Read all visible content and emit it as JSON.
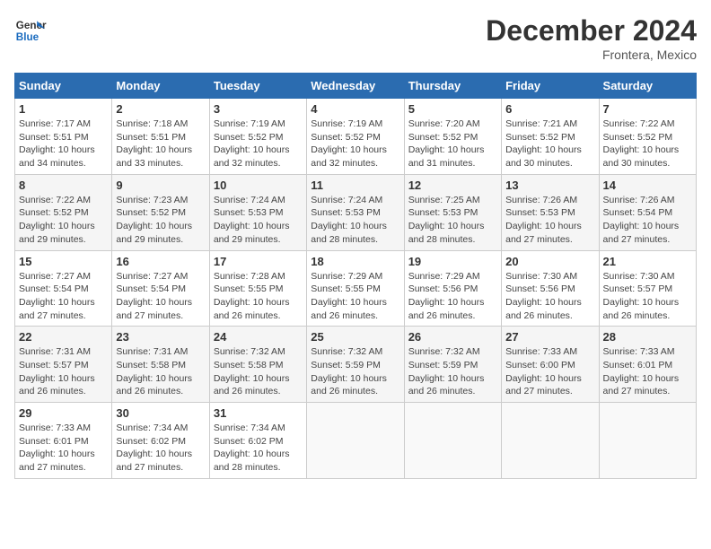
{
  "header": {
    "logo_line1": "General",
    "logo_line2": "Blue",
    "month_title": "December 2024",
    "location": "Frontera, Mexico"
  },
  "weekdays": [
    "Sunday",
    "Monday",
    "Tuesday",
    "Wednesday",
    "Thursday",
    "Friday",
    "Saturday"
  ],
  "weeks": [
    [
      {
        "day": "1",
        "sunrise": "7:17 AM",
        "sunset": "5:51 PM",
        "daylight": "10 hours and 34 minutes."
      },
      {
        "day": "2",
        "sunrise": "7:18 AM",
        "sunset": "5:51 PM",
        "daylight": "10 hours and 33 minutes."
      },
      {
        "day": "3",
        "sunrise": "7:19 AM",
        "sunset": "5:52 PM",
        "daylight": "10 hours and 32 minutes."
      },
      {
        "day": "4",
        "sunrise": "7:19 AM",
        "sunset": "5:52 PM",
        "daylight": "10 hours and 32 minutes."
      },
      {
        "day": "5",
        "sunrise": "7:20 AM",
        "sunset": "5:52 PM",
        "daylight": "10 hours and 31 minutes."
      },
      {
        "day": "6",
        "sunrise": "7:21 AM",
        "sunset": "5:52 PM",
        "daylight": "10 hours and 30 minutes."
      },
      {
        "day": "7",
        "sunrise": "7:22 AM",
        "sunset": "5:52 PM",
        "daylight": "10 hours and 30 minutes."
      }
    ],
    [
      {
        "day": "8",
        "sunrise": "7:22 AM",
        "sunset": "5:52 PM",
        "daylight": "10 hours and 29 minutes."
      },
      {
        "day": "9",
        "sunrise": "7:23 AM",
        "sunset": "5:52 PM",
        "daylight": "10 hours and 29 minutes."
      },
      {
        "day": "10",
        "sunrise": "7:24 AM",
        "sunset": "5:53 PM",
        "daylight": "10 hours and 29 minutes."
      },
      {
        "day": "11",
        "sunrise": "7:24 AM",
        "sunset": "5:53 PM",
        "daylight": "10 hours and 28 minutes."
      },
      {
        "day": "12",
        "sunrise": "7:25 AM",
        "sunset": "5:53 PM",
        "daylight": "10 hours and 28 minutes."
      },
      {
        "day": "13",
        "sunrise": "7:26 AM",
        "sunset": "5:53 PM",
        "daylight": "10 hours and 27 minutes."
      },
      {
        "day": "14",
        "sunrise": "7:26 AM",
        "sunset": "5:54 PM",
        "daylight": "10 hours and 27 minutes."
      }
    ],
    [
      {
        "day": "15",
        "sunrise": "7:27 AM",
        "sunset": "5:54 PM",
        "daylight": "10 hours and 27 minutes."
      },
      {
        "day": "16",
        "sunrise": "7:27 AM",
        "sunset": "5:54 PM",
        "daylight": "10 hours and 27 minutes."
      },
      {
        "day": "17",
        "sunrise": "7:28 AM",
        "sunset": "5:55 PM",
        "daylight": "10 hours and 26 minutes."
      },
      {
        "day": "18",
        "sunrise": "7:29 AM",
        "sunset": "5:55 PM",
        "daylight": "10 hours and 26 minutes."
      },
      {
        "day": "19",
        "sunrise": "7:29 AM",
        "sunset": "5:56 PM",
        "daylight": "10 hours and 26 minutes."
      },
      {
        "day": "20",
        "sunrise": "7:30 AM",
        "sunset": "5:56 PM",
        "daylight": "10 hours and 26 minutes."
      },
      {
        "day": "21",
        "sunrise": "7:30 AM",
        "sunset": "5:57 PM",
        "daylight": "10 hours and 26 minutes."
      }
    ],
    [
      {
        "day": "22",
        "sunrise": "7:31 AM",
        "sunset": "5:57 PM",
        "daylight": "10 hours and 26 minutes."
      },
      {
        "day": "23",
        "sunrise": "7:31 AM",
        "sunset": "5:58 PM",
        "daylight": "10 hours and 26 minutes."
      },
      {
        "day": "24",
        "sunrise": "7:32 AM",
        "sunset": "5:58 PM",
        "daylight": "10 hours and 26 minutes."
      },
      {
        "day": "25",
        "sunrise": "7:32 AM",
        "sunset": "5:59 PM",
        "daylight": "10 hours and 26 minutes."
      },
      {
        "day": "26",
        "sunrise": "7:32 AM",
        "sunset": "5:59 PM",
        "daylight": "10 hours and 26 minutes."
      },
      {
        "day": "27",
        "sunrise": "7:33 AM",
        "sunset": "6:00 PM",
        "daylight": "10 hours and 27 minutes."
      },
      {
        "day": "28",
        "sunrise": "7:33 AM",
        "sunset": "6:01 PM",
        "daylight": "10 hours and 27 minutes."
      }
    ],
    [
      {
        "day": "29",
        "sunrise": "7:33 AM",
        "sunset": "6:01 PM",
        "daylight": "10 hours and 27 minutes."
      },
      {
        "day": "30",
        "sunrise": "7:34 AM",
        "sunset": "6:02 PM",
        "daylight": "10 hours and 27 minutes."
      },
      {
        "day": "31",
        "sunrise": "7:34 AM",
        "sunset": "6:02 PM",
        "daylight": "10 hours and 28 minutes."
      },
      null,
      null,
      null,
      null
    ]
  ]
}
